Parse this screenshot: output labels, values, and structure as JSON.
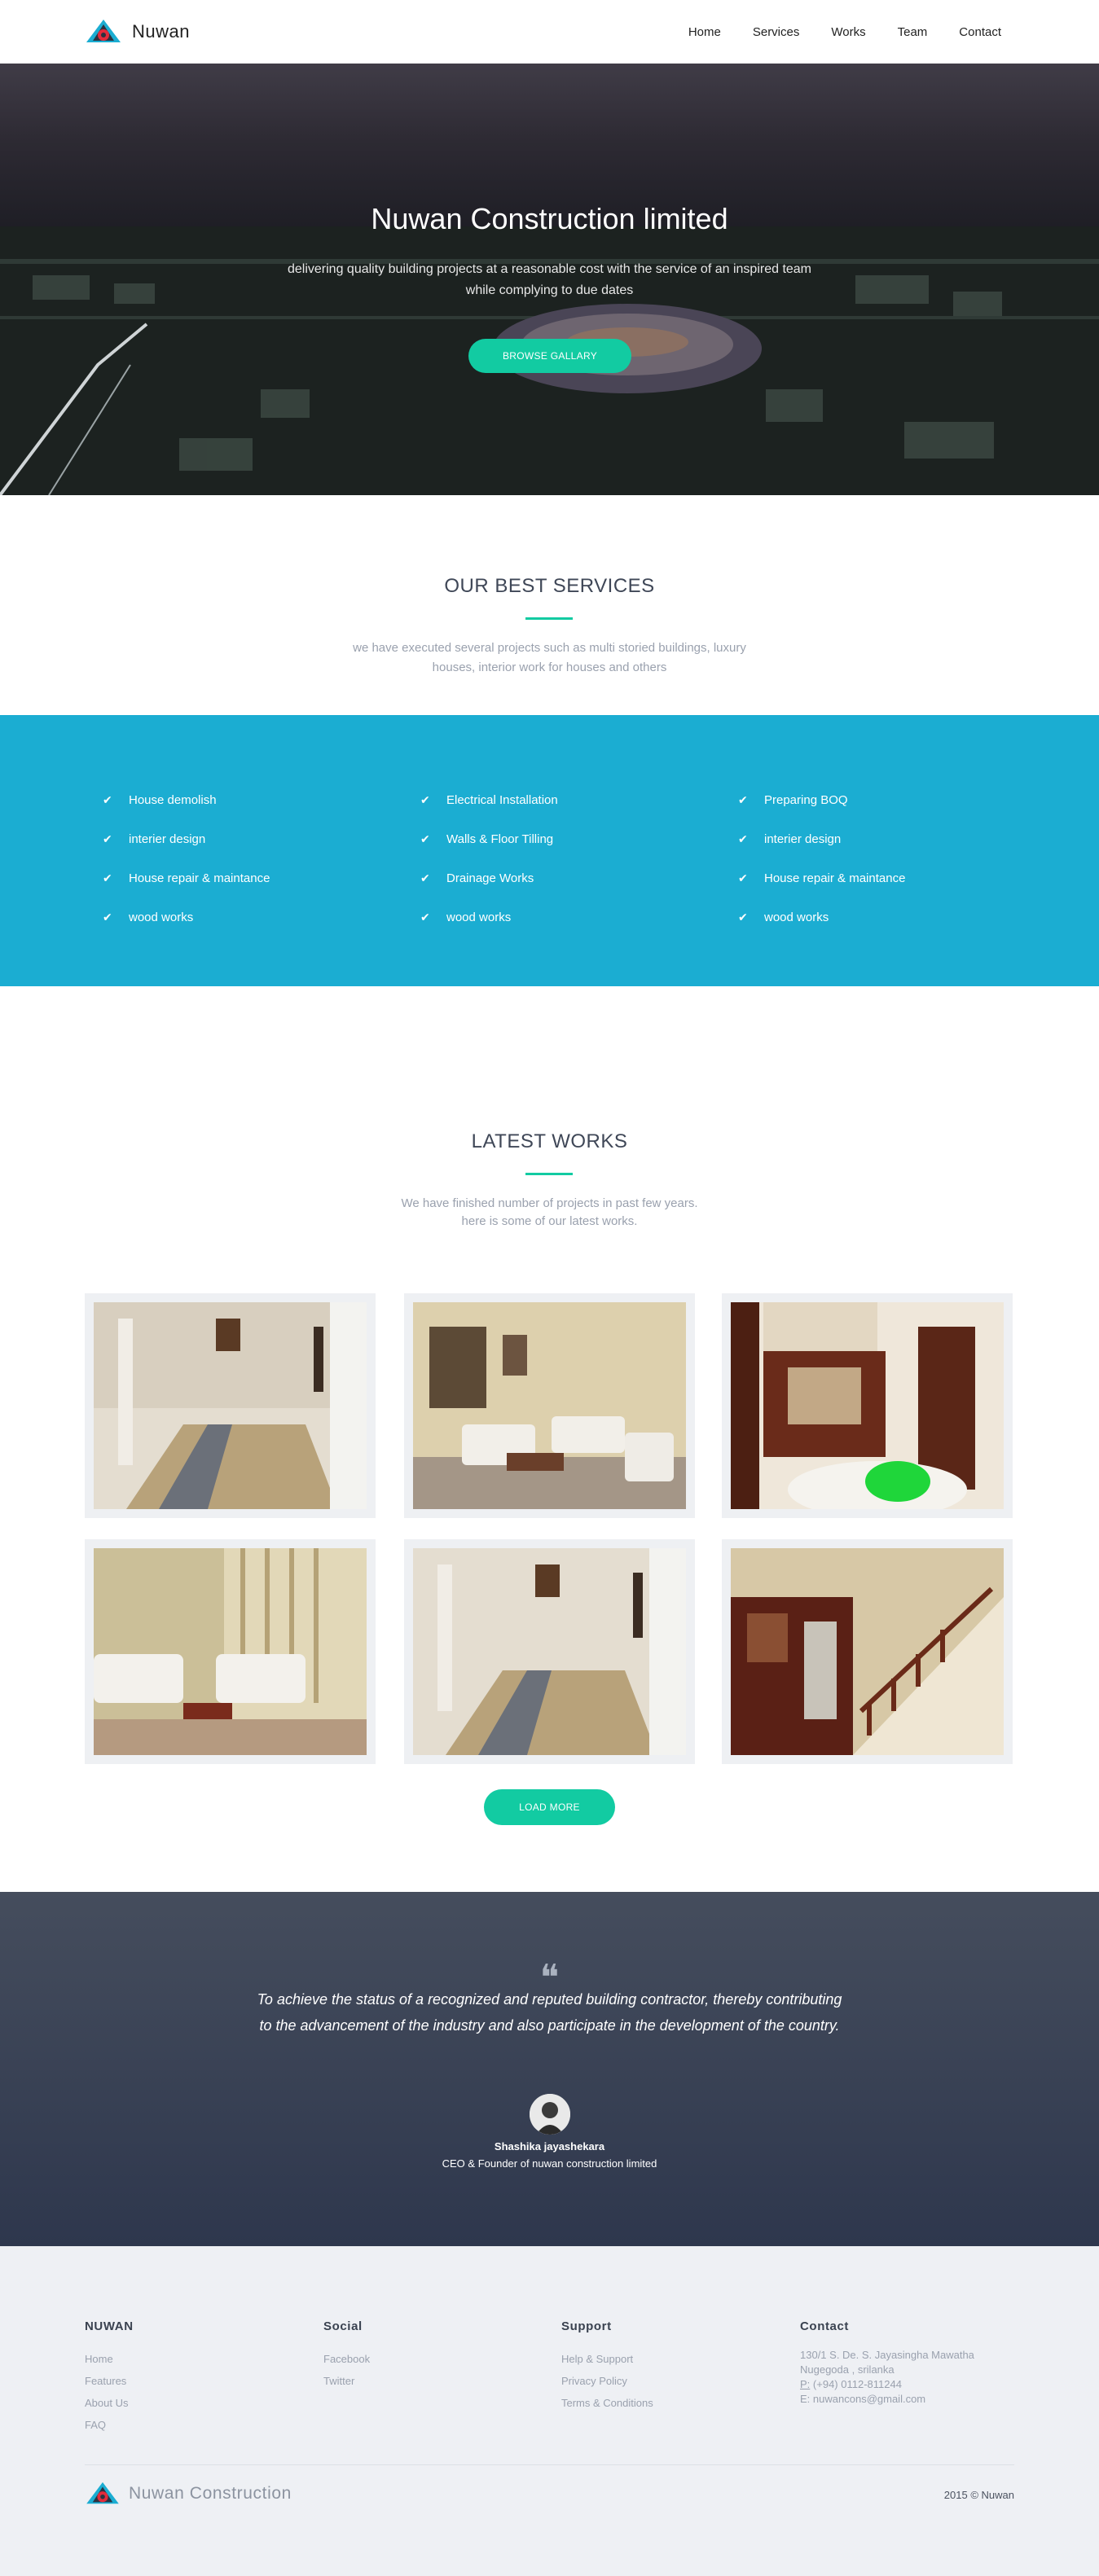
{
  "nav": {
    "brand": "Nuwan",
    "items": [
      {
        "label": "Home"
      },
      {
        "label": "Services"
      },
      {
        "label": "Works"
      },
      {
        "label": "Team"
      },
      {
        "label": "Contact"
      }
    ]
  },
  "hero": {
    "title": "Nuwan Construction limited",
    "subtitle": "delivering quality building projects at a reasonable cost with the service of an inspired team while complying to due dates",
    "button": "BROWSE GALLARY"
  },
  "services": {
    "title": "OUR BEST SERVICES",
    "subtitle": "we have executed several projects such as multi storied buildings, luxury houses, interior work for houses and others",
    "columns": [
      [
        "House demolish",
        "interier design",
        "House repair & maintance",
        "wood works"
      ],
      [
        "Electrical Installation",
        "Walls & Floor Tilling",
        "Drainage Works",
        "wood works"
      ],
      [
        "Preparing BOQ",
        "interier design",
        "House repair & maintance",
        "wood works"
      ]
    ]
  },
  "works": {
    "title": "LATEST WORKS",
    "subtitle_line1": "We have finished number of projects in past few years.",
    "subtitle_line2": "here is some of our latest works.",
    "load_more": "LOAD MORE"
  },
  "quote": {
    "text": "To achieve the status of a recognized and reputed building contractor, thereby contributing to the advancement of the industry and also participate in the development of the country.",
    "name": "Shashika jayashekara",
    "role": "CEO & Founder of nuwan construction limited"
  },
  "footer": {
    "col1": {
      "title": "NUWAN",
      "links": [
        "Home",
        "Features",
        "About Us",
        "FAQ"
      ]
    },
    "col2": {
      "title": "Social",
      "links": [
        "Facebook",
        "Twitter"
      ]
    },
    "col3": {
      "title": "Support",
      "links": [
        "Help & Support",
        "Privacy Policy",
        "Terms & Conditions"
      ]
    },
    "col4": {
      "title": "Contact",
      "address1": "130/1 S. De. S. Jayasingha Mawatha",
      "address2": "Nugegoda , srilanka",
      "phone_label": "P:",
      "phone": "(+94) 0112-811244",
      "email_label": "E:",
      "email": "nuwancons@gmail.com"
    },
    "brand": "Nuwan Construction",
    "copyright": "2015 © Nuwan"
  },
  "colors": {
    "accent": "#12cba2",
    "services_bg": "#1badd2",
    "quote_bg": "#2e374d",
    "footer_bg": "#eef0f4"
  }
}
